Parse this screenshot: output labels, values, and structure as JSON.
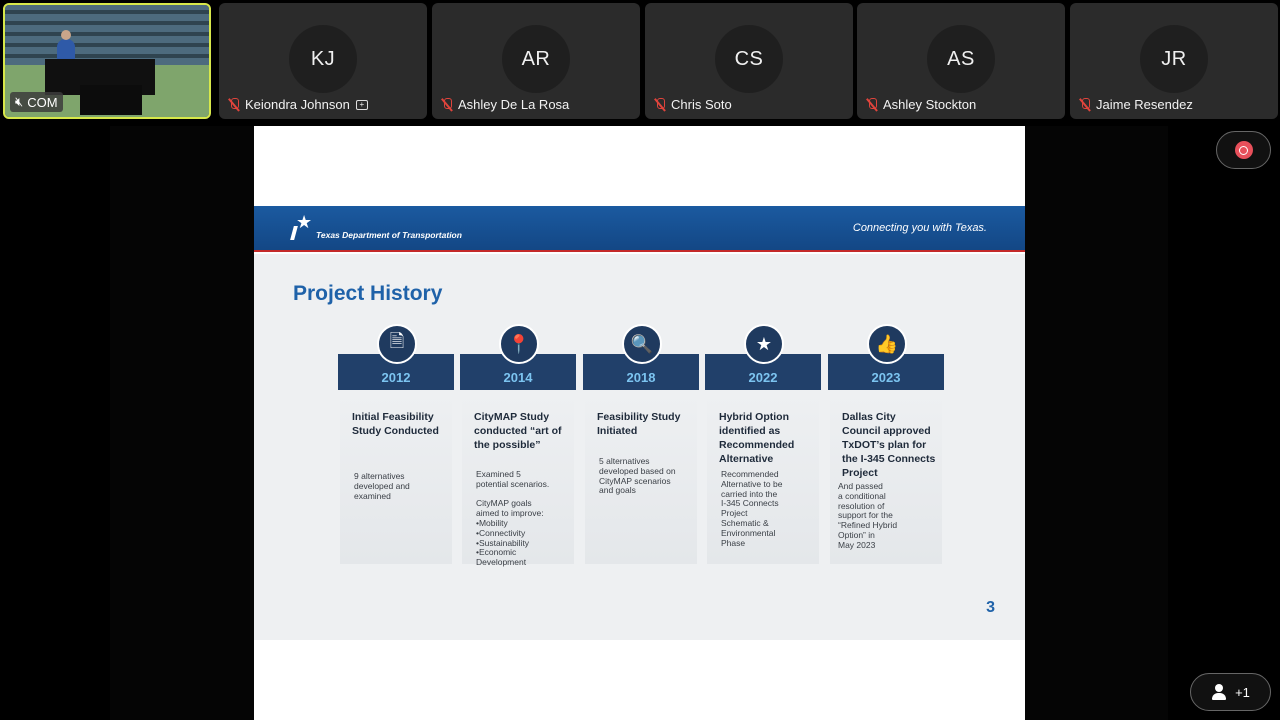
{
  "participants": {
    "video": {
      "label": "COM"
    },
    "tiles": [
      {
        "initials": "KJ",
        "name": "Keiondra Johnson",
        "pinned": true
      },
      {
        "initials": "AR",
        "name": "Ashley De La Rosa"
      },
      {
        "initials": "CS",
        "name": "Chris Soto"
      },
      {
        "initials": "AS",
        "name": "Ashley Stockton"
      },
      {
        "initials": "JR",
        "name": "Jaime Resendez"
      }
    ]
  },
  "slide": {
    "org": "Texas Department of Transportation",
    "tagline": "Connecting you with Texas.",
    "title": "Project History",
    "page_number": "3",
    "cards": [
      {
        "year": "2012",
        "icon": "document-search-icon",
        "glyph": "🗎",
        "headline": "Initial Feasibility Study Conducted",
        "detail": "9 alternatives\ndeveloped and\nexamined"
      },
      {
        "year": "2014",
        "icon": "map-pin-icon",
        "glyph": "📍",
        "headline": "CityMAP Study conducted “art of the possible”",
        "detail": "Examined 5\npotential scenarios.\n\nCityMAP goals\naimed to improve:\n•Mobility\n•Connectivity\n•Sustainability\n•Economic\n  Development"
      },
      {
        "year": "2018",
        "icon": "map-search-icon",
        "glyph": "🔍",
        "headline": "Feasibility Study Initiated",
        "detail": "5 alternatives\ndeveloped based on\nCityMAP scenarios\nand goals"
      },
      {
        "year": "2022",
        "icon": "star-icon",
        "glyph": "★",
        "headline": "Hybrid Option identified as Recommended Alternative",
        "detail": "Recommended\nAlternative to be\ncarried into the\nI-345 Connects\nProject\nSchematic &\nEnvironmental\nPhase"
      },
      {
        "year": "2023",
        "icon": "thumbs-up-icon",
        "glyph": "👍",
        "headline": "Dallas City Council approved TxDOT’s plan for the I-345 Connects Project",
        "detail": "And passed\na conditional\nresolution of\nsupport for the\n“Refined Hybrid\nOption” in\nMay 2023"
      }
    ]
  },
  "controls": {
    "participants_extra": "+1"
  },
  "colors": {
    "slide_title": "#1f62a9",
    "banner": "#1b5aa0",
    "year_bar": "#21406a",
    "year_text": "#7cc4f0",
    "record": "#e8505b",
    "video_border": "#d7e84a"
  }
}
